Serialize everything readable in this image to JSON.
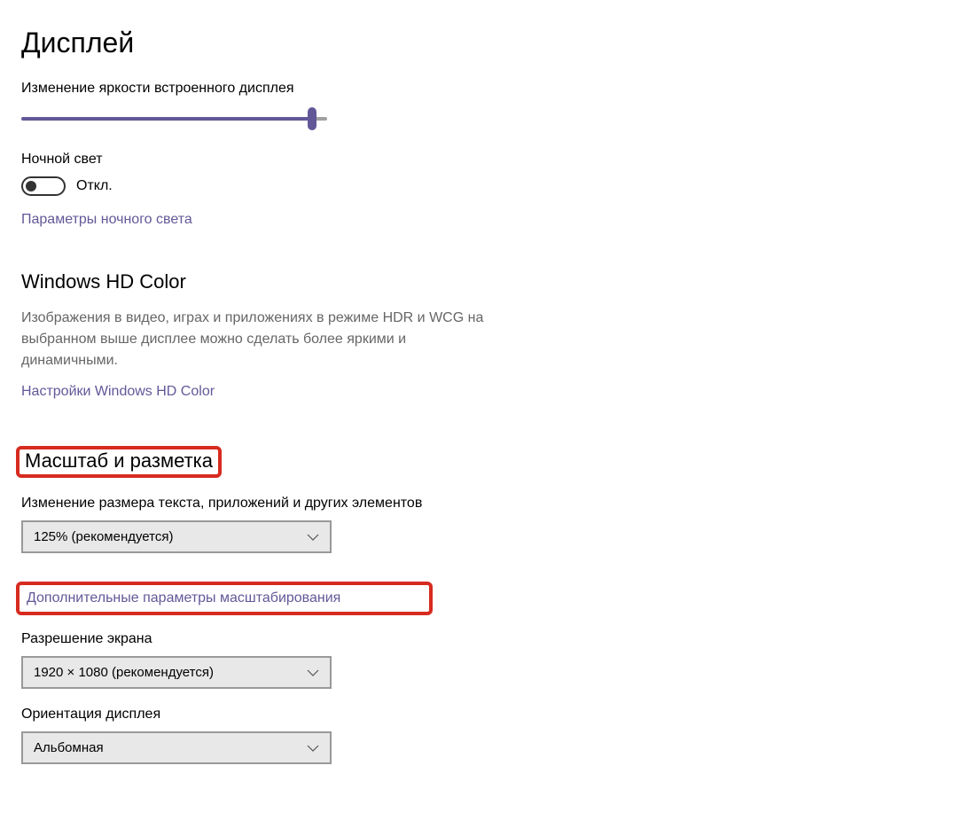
{
  "page": {
    "title": "Дисплей"
  },
  "brightness": {
    "label": "Изменение яркости встроенного дисплея",
    "value": 95
  },
  "nightLight": {
    "label": "Ночной свет",
    "state": "Откл.",
    "settingsLink": "Параметры ночного света"
  },
  "hdColor": {
    "title": "Windows HD Color",
    "description": "Изображения в видео, играх и приложениях в режиме HDR и WCG на выбранном выше дисплее можно сделать более яркими и динамичными.",
    "settingsLink": "Настройки Windows HD Color"
  },
  "scale": {
    "title": "Масштаб и разметка",
    "scaleLabel": "Изменение размера текста, приложений и других элементов",
    "scaleValue": "125% (рекомендуется)",
    "advancedLink": "Дополнительные параметры масштабирования",
    "resolutionLabel": "Разрешение экрана",
    "resolutionValue": "1920 × 1080 (рекомендуется)",
    "orientationLabel": "Ориентация дисплея",
    "orientationValue": "Альбомная"
  }
}
